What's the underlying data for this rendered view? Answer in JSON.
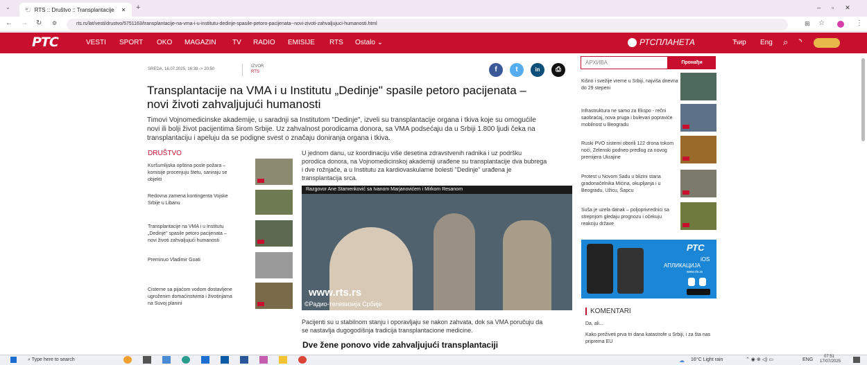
{
  "browser": {
    "tab_title": "RTS :: Društvo :: Transplantacije",
    "url": "rts.rs/lat/vesti/drustvo/5751163/transplantacije-na-vma-i-u-institutu-dedinje-spasile-petoro-pacijenata--novi-zivoti-zahvaljujuci-humanosti.html"
  },
  "nav": {
    "logo": "РТС",
    "items": [
      "VESTI",
      "SPORT",
      "OKO",
      "MAGAZIN",
      "TV",
      "RADIO",
      "EMISIJE",
      "RTS",
      "Ostalo"
    ],
    "planeta": "РТСПЛАНЕТА",
    "script_cyr": "Ћир",
    "lang": "Eng"
  },
  "article": {
    "date": "SREDA, 16.07.2025, 16:39 -> 20:50",
    "source_label": "IZVOR",
    "source": "RTS",
    "title": "Transplantacije na VMA i u Institutu „Dedinje\" spasile petoro pacijenata – novi životi zahvaljujući humanosti",
    "lead": "Timovi Vojnomedicinske akademije, u saradnji sa Institutom \"Dedinje\", izveli su transplantacije organa i tkiva koje su omogućile novi ili bolji život pacijentima širom Srbije. Uz zahvalnost porodicama donora, sa VMA podsećaju da u Srbiji 1.800 ljudi čeka na transplantaciju i apeluju da se podigne svest o značaju doniranja organa i tkiva.",
    "body1": "U jednom danu, uz koordinaciju više desetina zdravstvenih radnika i uz podršku porodica donora, na Vojnomedicinskoj akademiji urađene su transplantacije dva bubrega i dve rožnjače, a u Institutu za kardiovaskularne bolesti \"Dedinje\" urađena je transplantacija srca.",
    "video_caption": "Razgovor Ane Stamenković sa Ivanom Marjanovićem i Mirkom Resanom",
    "watermark": "www.rts.rs",
    "watermark2": "©Радио-телевизија Србије",
    "body2": "Pacijenti su u stabilnom stanju i oporavljaju se nakon zahvata, dok sa VMA poručuju da se nastavlja dugogodišnja tradicija transplantacione medicine.",
    "subhead": "Dve žene ponovo vide zahvaljujući transplantaciji"
  },
  "social": [
    "f",
    "t",
    "in",
    "⎙"
  ],
  "left_section": {
    "title": "DRUŠTVO",
    "items": [
      "Kuršumlijska opština posle požara – komisije procenjuju štetu, saniraju se objekti",
      "Redovna zamena kontingenta Vojske Srbije u Libanu",
      "Transplantacije na VMA i u Institutu „Dedinje\" spasile petoro pacijenata – novi životi zahvaljujući humanosti",
      "Preminuo Vladimir Goati",
      "Cisterne sa pijaćom vodom dostavljene ugroženim domaćinstvima i životinjama na Suvoj planini"
    ]
  },
  "right": {
    "search_placeholder": "АРХИВА",
    "search_button": "Пронађи",
    "items": [
      "Kišno i svežije vreme u Srbiji, najviša dnevna do 29 stepeni",
      "Infrastruktura ne samo za Ekspo - rečni saobraćaj, nova pruga i bulevari popraviće mobilnost u Beogradu",
      "Ruski PVO sistemi oborili 122 drona tokom noći, Zelenski podneo predlog za novog premijera Ukrajine",
      "Protest u Novom Sadu u blizini stana gradonačelnika Mićina, okupljanja i u Beogradu, Užicu, Šapcu",
      "Suša je uzela danak – poljoprivrednici sa strepnjom gledaju prognozu i očekuju reakciju države"
    ],
    "ad_logo": "РТС",
    "ad_text1": "iOS",
    "ad_text2": "АПЛИКАЦИЈА",
    "ad_url": "www.rts.rs",
    "comments_title": "KOMENTARI",
    "comment1": "Da, ali...",
    "comment2": "Kako preživeti prva tri dana katastrofe u Srbiji, i za šta nas priprema EU"
  },
  "taskbar": {
    "search": "Type here to search",
    "weather": "16°C  Light rain",
    "lang": "ENG",
    "time": "07:51",
    "date": "17/07/2025"
  }
}
